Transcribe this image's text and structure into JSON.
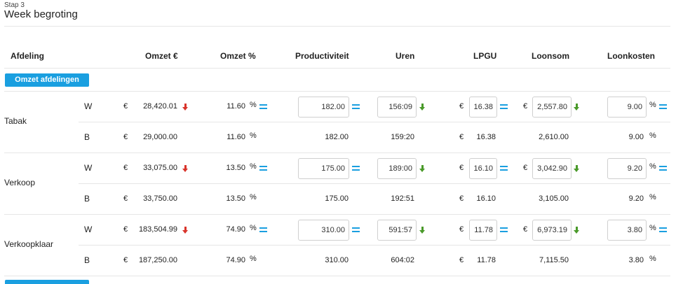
{
  "header": {
    "step": "Stap 3",
    "title": "Week begroting"
  },
  "columns": {
    "afdeling": "Afdeling",
    "omzet_eur": "Omzet €",
    "omzet_pct": "Omzet %",
    "productiviteit": "Productiviteit",
    "uren": "Uren",
    "lpgu": "LPGU",
    "loonsom": "Loonsom",
    "loonkosten": "Loonkosten"
  },
  "omzet_button": "Omzet afdelingen",
  "symbols": {
    "euro": "€",
    "percent": "%"
  },
  "icons": {
    "trend_down_red": "arrow-down-red-icon",
    "trend_down_green": "arrow-down-green-icon",
    "equal": "equals-icon"
  },
  "colors": {
    "accent": "#1a9fe0",
    "down_red": "#d9342b",
    "down_green": "#4a9a2a"
  },
  "departments": [
    {
      "name": "Tabak",
      "w": {
        "label": "W",
        "omzet": "28,420.01",
        "omzet_pct": "11.60",
        "productiviteit": "182.00",
        "uren": "156:09",
        "lpgu": "16.38",
        "loonsom": "2,557.80",
        "loonkosten": "9.00"
      },
      "b": {
        "label": "B",
        "omzet": "29,000.00",
        "omzet_pct": "11.60",
        "productiviteit": "182.00",
        "uren": "159:20",
        "lpgu": "16.38",
        "loonsom": "2,610.00",
        "loonkosten": "9.00"
      }
    },
    {
      "name": "Verkoop",
      "w": {
        "label": "W",
        "omzet": "33,075.00",
        "omzet_pct": "13.50",
        "productiviteit": "175.00",
        "uren": "189:00",
        "lpgu": "16.10",
        "loonsom": "3,042.90",
        "loonkosten": "9.20"
      },
      "b": {
        "label": "B",
        "omzet": "33,750.00",
        "omzet_pct": "13.50",
        "productiviteit": "175.00",
        "uren": "192:51",
        "lpgu": "16.10",
        "loonsom": "3,105.00",
        "loonkosten": "9.20"
      }
    },
    {
      "name": "Verkoopklaar",
      "w": {
        "label": "W",
        "omzet": "183,504.99",
        "omzet_pct": "74.90",
        "productiviteit": "310.00",
        "uren": "591:57",
        "lpgu": "11.78",
        "loonsom": "6,973.19",
        "loonkosten": "3.80"
      },
      "b": {
        "label": "B",
        "omzet": "187,250.00",
        "omzet_pct": "74.90",
        "productiviteit": "310.00",
        "uren": "604:02",
        "lpgu": "11.78",
        "loonsom": "7,115.50",
        "loonkosten": "3.80"
      }
    }
  ]
}
